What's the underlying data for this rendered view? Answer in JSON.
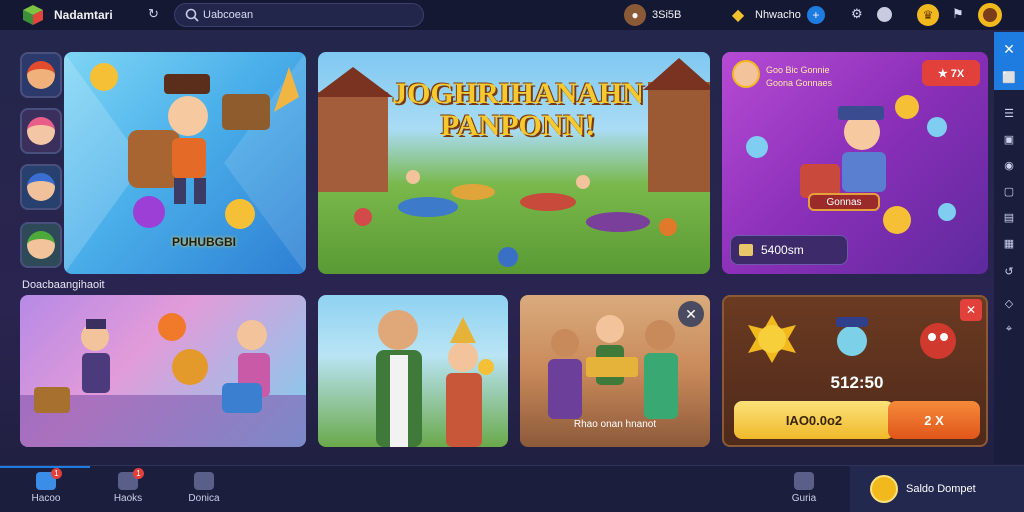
{
  "header": {
    "app_name": "Nadamtari",
    "search_value": "Uabcoean",
    "coins": "3Si5B",
    "gems": "Nhwacho",
    "icons": [
      "refresh-icon",
      "search-icon",
      "coin-icon",
      "gem-icon",
      "settings-icon",
      "record-icon",
      "trophy-icon",
      "flag-icon",
      "profile-icon"
    ]
  },
  "hero": {
    "left_card_label": "PUHUBGBI",
    "center_title_line1": "JOGHRIHANAHN",
    "center_title_line2": "PANPONN!",
    "right_card": {
      "title_line1": "Goo Bic Gonnie",
      "title_line2": "Goona Gonnaes",
      "tag": "★ 7X",
      "banner": "Gonnas",
      "amount": "5400sm"
    }
  },
  "section_label": "Doacbaangihaoit",
  "tiles": {
    "tile4_caption": "Rhao onan hnanot",
    "prize_amount": "512:50",
    "prize_input": "IAO0.0o2",
    "prize_button": "2 X"
  },
  "bottom_nav": [
    {
      "label": "Hacoo",
      "badge": "1"
    },
    {
      "label": "Haoks",
      "badge": "1"
    },
    {
      "label": "Donica",
      "badge": ""
    },
    {
      "label": "Guria",
      "badge": ""
    }
  ],
  "wallet": {
    "label": "Saldo Dompet"
  },
  "colors": {
    "accent_blue": "#1e7be0",
    "gold": "#f2b91f",
    "red": "#e2403b",
    "orange": "#f06a1d",
    "background": "#23264a"
  }
}
